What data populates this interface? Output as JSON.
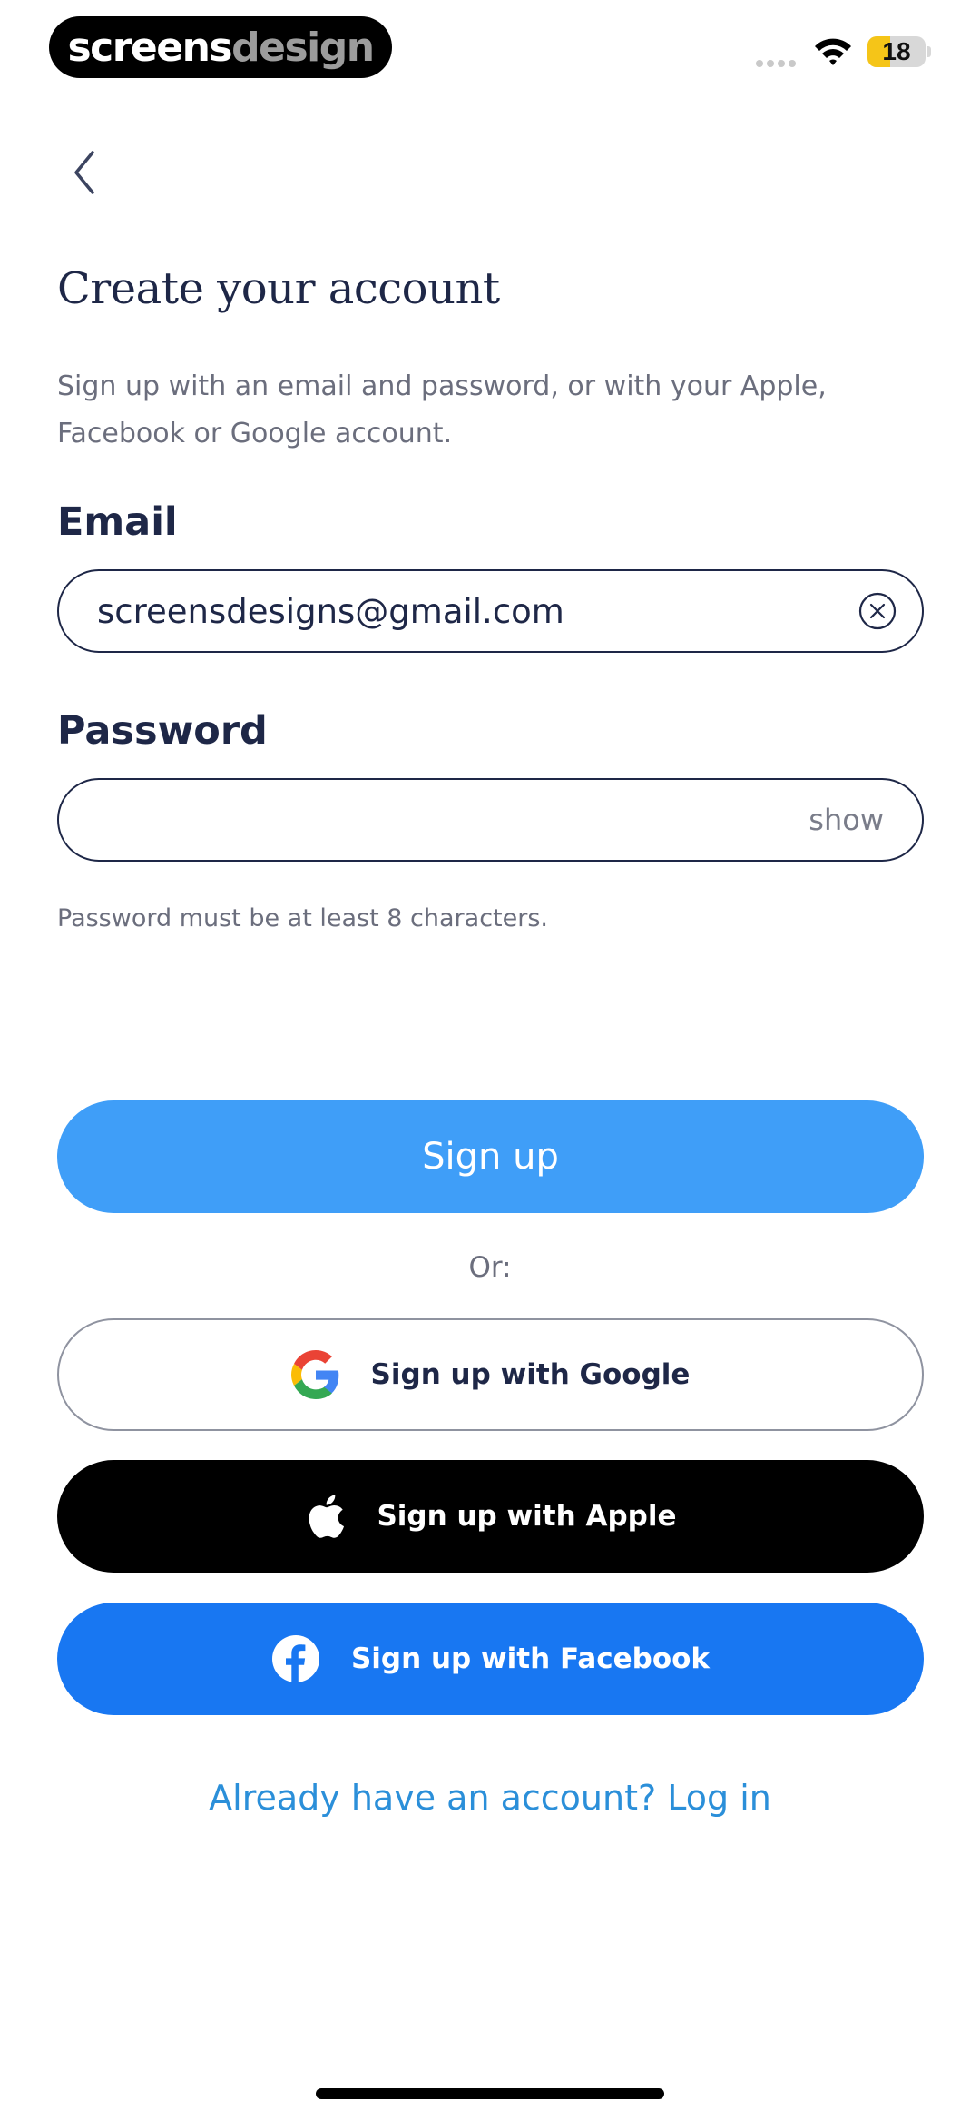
{
  "status_bar": {
    "brand_part1": "screens",
    "brand_part2": "design",
    "battery_level": "18",
    "battery_fraction": 0.18
  },
  "header": {
    "back_icon": "chevron-left-icon"
  },
  "page": {
    "title": "Create your account",
    "subtitle": "Sign up with an email and password, or with your Apple, Facebook or Google account."
  },
  "form": {
    "email_label": "Email",
    "email_value": "screensdesigns@gmail.com",
    "password_label": "Password",
    "password_value": "",
    "show_label": "show",
    "password_hint": "Password must be at least 8 characters."
  },
  "actions": {
    "signup_label": "Sign up",
    "or_label": "Or:",
    "google_label": "Sign up with Google",
    "apple_label": "Sign up with Apple",
    "facebook_label": "Sign up with Facebook",
    "login_link": "Already have an account? Log in"
  },
  "colors": {
    "primary": "#3f9ef8",
    "facebook": "#1877f2",
    "apple": "#000000",
    "text_dark": "#1e2747",
    "link": "#2b8fd9"
  }
}
